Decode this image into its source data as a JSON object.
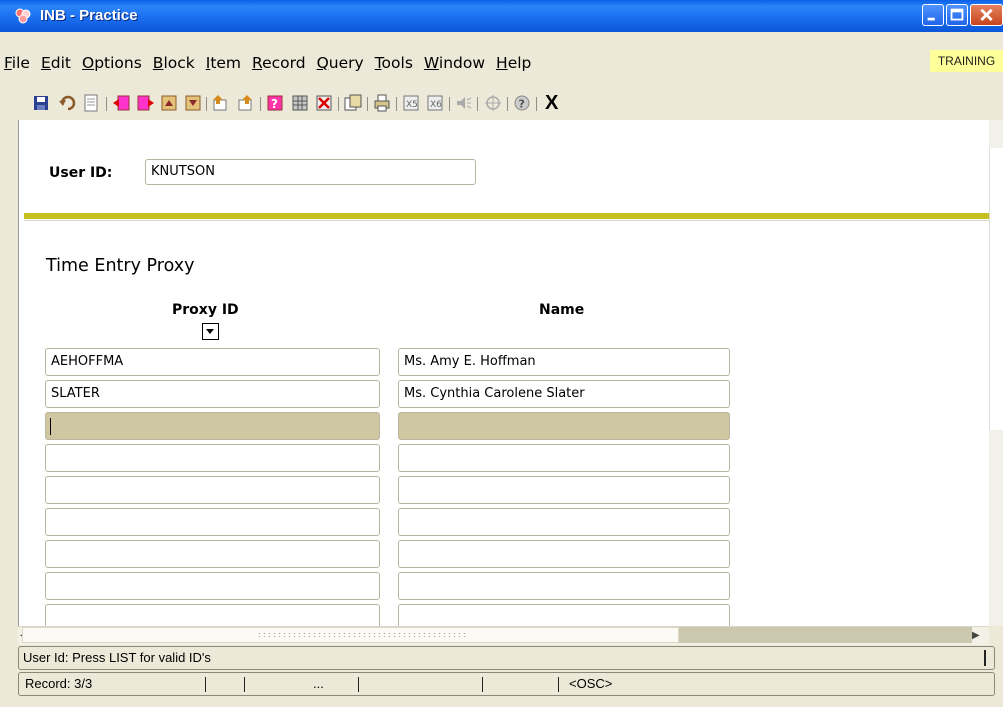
{
  "window": {
    "title": "INB - Practice",
    "controls": [
      "minimize",
      "maximize",
      "close"
    ]
  },
  "menu": {
    "items": [
      {
        "label": "File",
        "accel": "F"
      },
      {
        "label": "Edit",
        "accel": "E"
      },
      {
        "label": "Options",
        "accel": "O"
      },
      {
        "label": "Block",
        "accel": "B"
      },
      {
        "label": "Item",
        "accel": "I"
      },
      {
        "label": "Record",
        "accel": "R"
      },
      {
        "label": "Query",
        "accel": "Q"
      },
      {
        "label": "Tools",
        "accel": "T"
      },
      {
        "label": "Window",
        "accel": "W"
      },
      {
        "label": "Help",
        "accel": "H"
      }
    ],
    "environment_badge": "TRAINING"
  },
  "toolbar": {
    "icons": [
      "save-icon",
      "rollback-icon",
      "print-icon",
      "next-block-icon",
      "previous-block-icon",
      "next-record-icon",
      "previous-record-icon",
      "enter-query-icon",
      "execute-query-icon",
      "help-icon",
      "insert-record-icon",
      "delete-record-icon",
      "duplicate-icon",
      "print-screen-icon",
      "exit-icon-2",
      "exit-icon-3",
      "sound-icon",
      "crosshair-icon",
      "online-help-icon"
    ],
    "exit_label": "X"
  },
  "form": {
    "user_id_label": "User ID:",
    "user_id_value": "KNUTSON",
    "section_title": "Time Entry Proxy",
    "columns": {
      "proxy_id": "Proxy ID",
      "name": "Name"
    },
    "rows": [
      {
        "proxy_id": "AEHOFFMA",
        "name": "Ms. Amy E. Hoffman"
      },
      {
        "proxy_id": "SLATER",
        "name": "Ms. Cynthia Carolene Slater"
      },
      {
        "proxy_id": "",
        "name": "",
        "current": true
      },
      {
        "proxy_id": "",
        "name": ""
      },
      {
        "proxy_id": "",
        "name": ""
      },
      {
        "proxy_id": "",
        "name": ""
      },
      {
        "proxy_id": "",
        "name": ""
      },
      {
        "proxy_id": "",
        "name": ""
      },
      {
        "proxy_id": "",
        "name": ""
      }
    ]
  },
  "status": {
    "hint": "User Id:  Press LIST for valid ID's",
    "record": "Record: 3/3",
    "ellipsis": "...",
    "mode": "<OSC>"
  },
  "colors": {
    "titlebar": "#0b56d8",
    "divider": "#c5c020",
    "current_row": "#cec7a2",
    "training_badge": "#ffff99"
  }
}
